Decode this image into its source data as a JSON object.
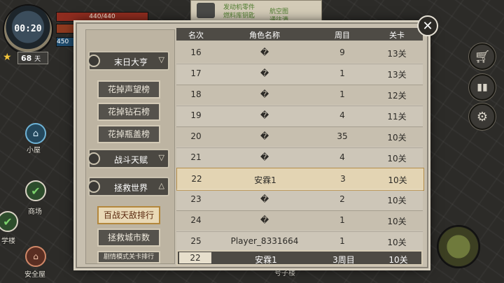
{
  "hud": {
    "time": "00:20",
    "hp": "440/440",
    "mp": "450",
    "level": "68",
    "level_suffix": "天"
  },
  "map": {
    "labels": [
      "小屋",
      "商场",
      "学楼",
      "安全屋",
      "号子楼"
    ]
  },
  "top_note": {
    "line1": "发动机零件",
    "line2": "燃料库钥匙",
    "line3": "航空图",
    "line4": "通往港"
  },
  "sidebar": {
    "categories": [
      {
        "label": "末日大亨",
        "arrow": "▽"
      },
      {
        "label": "战斗天赋",
        "arrow": "▽"
      },
      {
        "label": "拯救世界",
        "arrow": "△"
      }
    ],
    "items": [
      {
        "label": "花掉声望榜"
      },
      {
        "label": "花掉钻石榜"
      },
      {
        "label": "花掉瓶盖榜"
      },
      {
        "label": "百战天敌排行"
      },
      {
        "label": "拯救城市数"
      },
      {
        "label": "剧情模式关卡排行"
      }
    ]
  },
  "table": {
    "headers": [
      "名次",
      "角色名称",
      "周目",
      "关卡"
    ],
    "rows": [
      {
        "rank": "16",
        "name": "�",
        "cycle": "9",
        "stage": "13关"
      },
      {
        "rank": "17",
        "name": "�",
        "cycle": "1",
        "stage": "13关"
      },
      {
        "rank": "18",
        "name": "�",
        "cycle": "1",
        "stage": "12关"
      },
      {
        "rank": "19",
        "name": "�",
        "cycle": "4",
        "stage": "11关"
      },
      {
        "rank": "20",
        "name": "�",
        "cycle": "35",
        "stage": "10关"
      },
      {
        "rank": "21",
        "name": "�",
        "cycle": "4",
        "stage": "10关"
      },
      {
        "rank": "22",
        "name": "安霖1",
        "cycle": "3",
        "stage": "10关"
      },
      {
        "rank": "23",
        "name": "�",
        "cycle": "2",
        "stage": "10关"
      },
      {
        "rank": "24",
        "name": "�",
        "cycle": "1",
        "stage": "10关"
      },
      {
        "rank": "25",
        "name": "Player_8331664",
        "cycle": "1",
        "stage": "10关"
      }
    ],
    "my_row": {
      "rank": "22",
      "name": "安霖1",
      "cycle": "3周目",
      "stage": "10关"
    }
  },
  "close_label": "✕"
}
